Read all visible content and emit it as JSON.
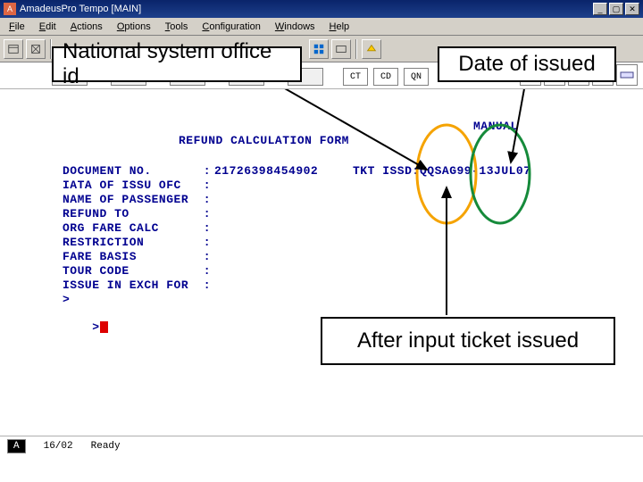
{
  "window": {
    "title": "AmadeusPro Tempo [MAIN]"
  },
  "menu": {
    "file": "File",
    "edit": "Edit",
    "actions": "Actions",
    "options": "Options",
    "tools": "Tools",
    "configuration": "Configuration",
    "windows": "Windows",
    "help": "Help"
  },
  "tabs": {
    "t1": "",
    "t2": "",
    "t3": "",
    "t4": "",
    "t5": "",
    "r1": "CT",
    "r2": "CD",
    "r3": "QN"
  },
  "annotations": {
    "office_id": "National system office id",
    "date_issued": "Date of issued",
    "after_input": "After input ticket issued"
  },
  "form": {
    "title": "REFUND CALCULATION FORM",
    "mode": "MANUAL",
    "rows": {
      "doc_no_label": "DOCUMENT NO.       :",
      "doc_no_value": "21726398454902",
      "tkt_issd_label": "TKT ISSD:",
      "tkt_issd_value": "QQSAG99-13JUL07",
      "iata_label": "IATA OF ISSU OFC   :",
      "name_label": "NAME OF PASSENGER  :",
      "refund_label": "REFUND TO          :",
      "org_fare_label": "ORG FARE CALC      :",
      "restrict_label": "RESTRICTION        :",
      "fare_basis": "FARE BASIS         :",
      "tour_code": "TOUR CODE          :",
      "issue_exch": "ISSUE IN EXCH FOR  :",
      "caret": ">",
      "prompt": ">"
    }
  },
  "status": {
    "a": "A",
    "pos": "16/02",
    "state": "Ready"
  }
}
